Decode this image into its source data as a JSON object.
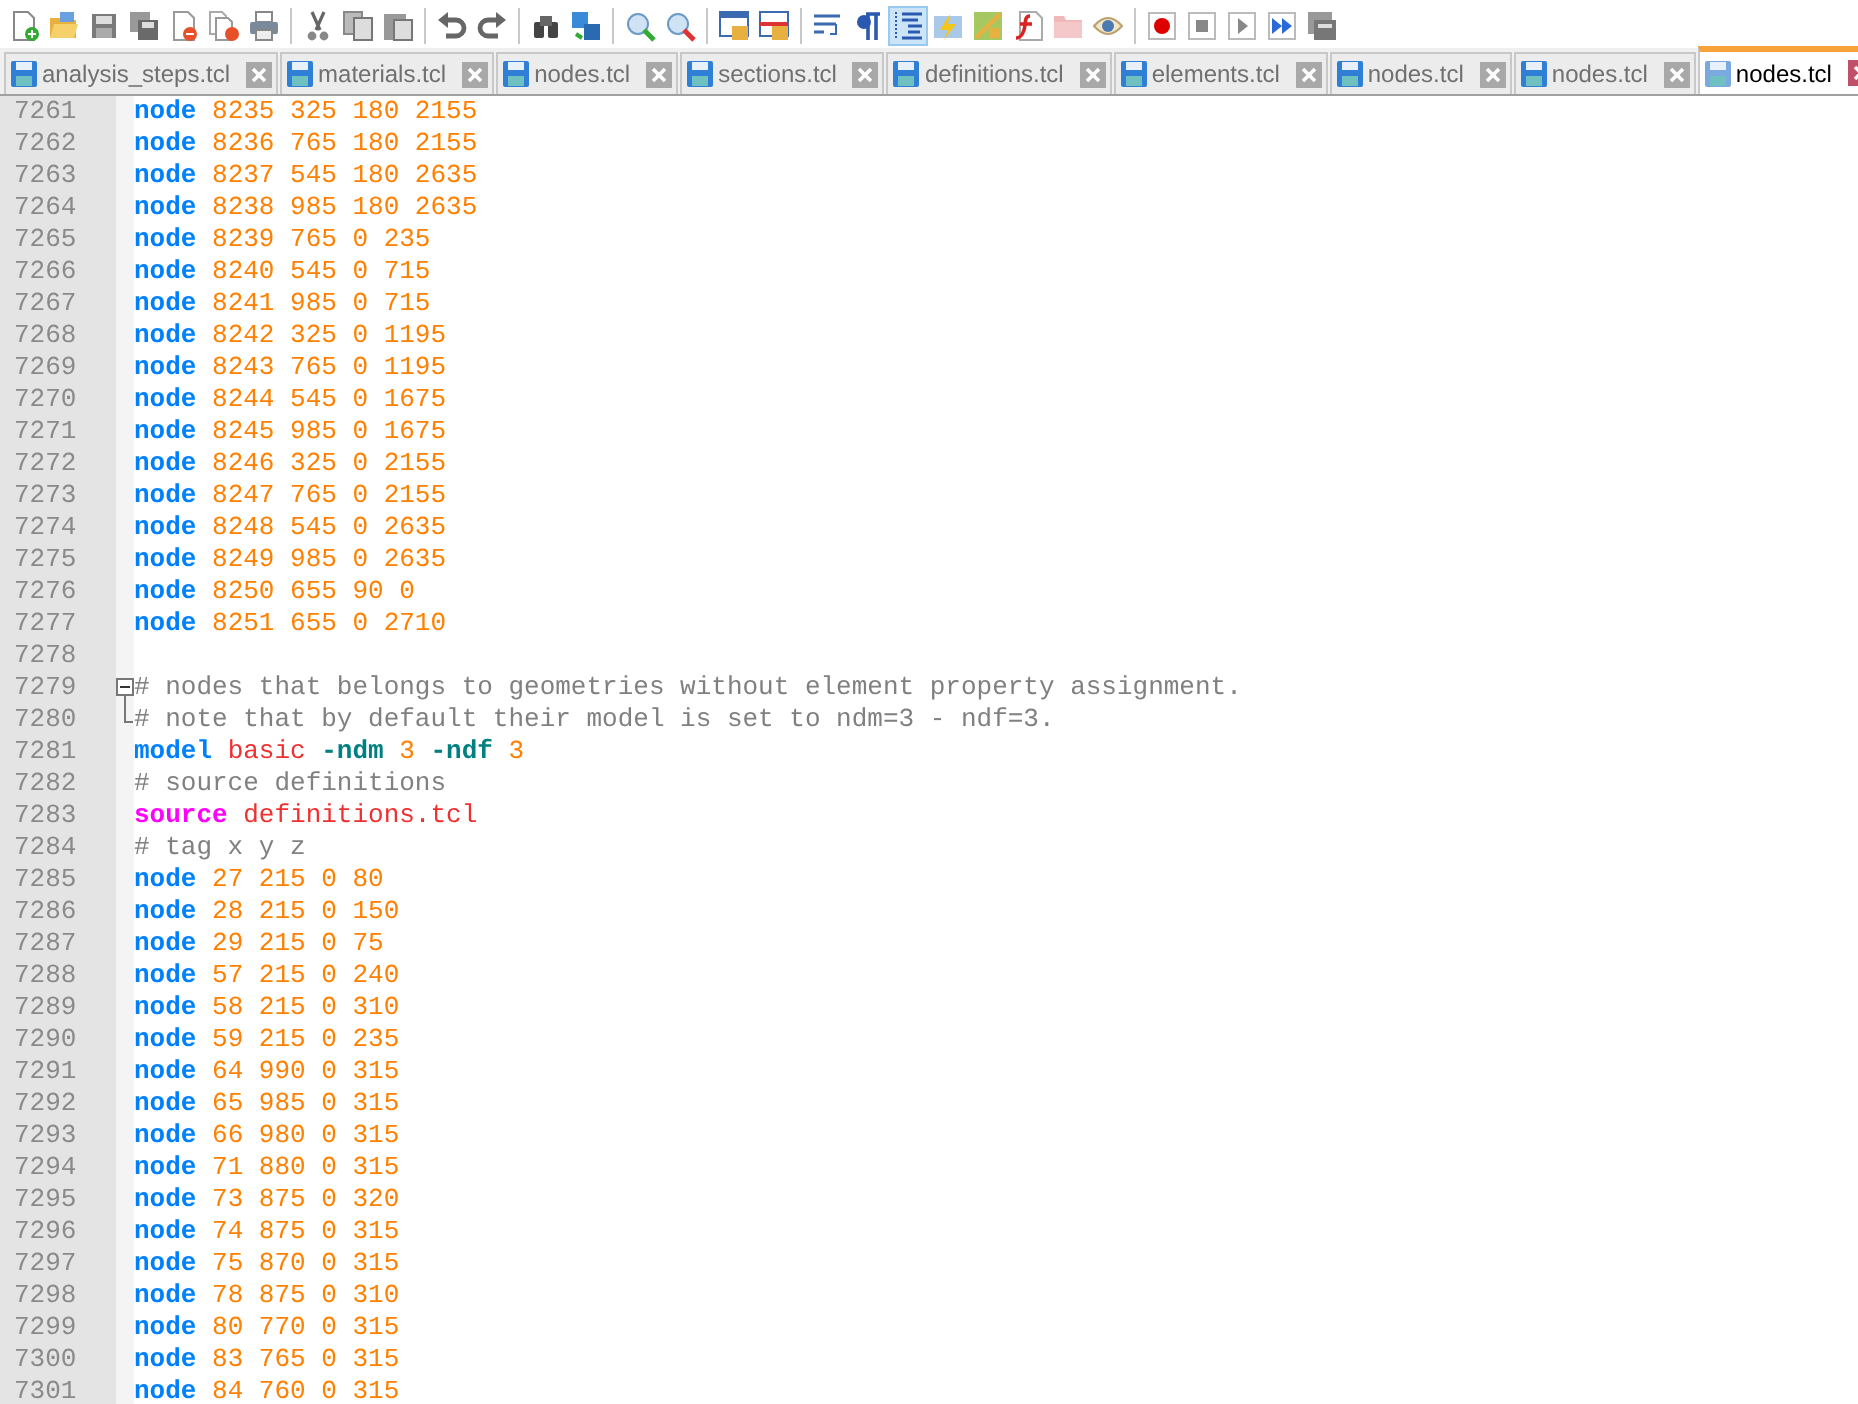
{
  "toolbar": [
    {
      "pressed": false
    },
    {
      "pressed": false
    },
    {
      "pressed": false
    },
    {
      "pressed": false
    },
    {
      "pressed": false
    },
    {
      "pressed": false
    },
    {
      "pressed": false
    },
    {
      "pressed": false
    },
    {
      "pressed": false
    },
    {
      "pressed": false
    },
    {
      "pressed": false
    },
    {
      "pressed": false
    },
    {
      "pressed": false
    },
    {
      "pressed": false
    },
    {
      "pressed": false
    },
    {
      "pressed": false
    },
    {
      "pressed": false
    },
    {
      "pressed": false
    },
    {
      "pressed": false
    },
    {
      "pressed": false
    },
    {
      "pressed": true
    },
    {
      "pressed": false
    },
    {
      "pressed": false
    },
    {
      "pressed": false
    },
    {
      "pressed": false
    },
    {
      "pressed": false
    },
    {
      "pressed": false
    },
    {
      "pressed": false
    },
    {
      "pressed": false
    },
    {
      "pressed": false
    },
    {
      "pressed": false
    }
  ],
  "tabs": [
    {
      "label": "analysis_steps.tcl",
      "selected": false
    },
    {
      "label": "materials.tcl",
      "selected": false
    },
    {
      "label": "nodes.tcl",
      "selected": false
    },
    {
      "label": "sections.tcl",
      "selected": false
    },
    {
      "label": "definitions.tcl",
      "selected": false
    },
    {
      "label": "elements.tcl",
      "selected": false
    },
    {
      "label": "nodes.tcl",
      "selected": false
    },
    {
      "label": "nodes.tcl",
      "selected": false
    },
    {
      "label": "nodes.tcl",
      "selected": true
    }
  ],
  "lines": [
    {
      "number": "7261",
      "tokens": [
        {
          "kind": "keyword",
          "text": "node"
        },
        {
          "kind": "number",
          "text": " 8235 325 180 2155"
        }
      ]
    },
    {
      "number": "7262",
      "tokens": [
        {
          "kind": "keyword",
          "text": "node"
        },
        {
          "kind": "number",
          "text": " 8236 765 180 2155"
        }
      ]
    },
    {
      "number": "7263",
      "tokens": [
        {
          "kind": "keyword",
          "text": "node"
        },
        {
          "kind": "number",
          "text": " 8237 545 180 2635"
        }
      ]
    },
    {
      "number": "7264",
      "tokens": [
        {
          "kind": "keyword",
          "text": "node"
        },
        {
          "kind": "number",
          "text": " 8238 985 180 2635"
        }
      ]
    },
    {
      "number": "7265",
      "tokens": [
        {
          "kind": "keyword",
          "text": "node"
        },
        {
          "kind": "number",
          "text": " 8239 765 0 235"
        }
      ]
    },
    {
      "number": "7266",
      "tokens": [
        {
          "kind": "keyword",
          "text": "node"
        },
        {
          "kind": "number",
          "text": " 8240 545 0 715"
        }
      ]
    },
    {
      "number": "7267",
      "tokens": [
        {
          "kind": "keyword",
          "text": "node"
        },
        {
          "kind": "number",
          "text": " 8241 985 0 715"
        }
      ]
    },
    {
      "number": "7268",
      "tokens": [
        {
          "kind": "keyword",
          "text": "node"
        },
        {
          "kind": "number",
          "text": " 8242 325 0 1195"
        }
      ]
    },
    {
      "number": "7269",
      "tokens": [
        {
          "kind": "keyword",
          "text": "node"
        },
        {
          "kind": "number",
          "text": " 8243 765 0 1195"
        }
      ]
    },
    {
      "number": "7270",
      "tokens": [
        {
          "kind": "keyword",
          "text": "node"
        },
        {
          "kind": "number",
          "text": " 8244 545 0 1675"
        }
      ]
    },
    {
      "number": "7271",
      "tokens": [
        {
          "kind": "keyword",
          "text": "node"
        },
        {
          "kind": "number",
          "text": " 8245 985 0 1675"
        }
      ]
    },
    {
      "number": "7272",
      "tokens": [
        {
          "kind": "keyword",
          "text": "node"
        },
        {
          "kind": "number",
          "text": " 8246 325 0 2155"
        }
      ]
    },
    {
      "number": "7273",
      "tokens": [
        {
          "kind": "keyword",
          "text": "node"
        },
        {
          "kind": "number",
          "text": " 8247 765 0 2155"
        }
      ]
    },
    {
      "number": "7274",
      "tokens": [
        {
          "kind": "keyword",
          "text": "node"
        },
        {
          "kind": "number",
          "text": " 8248 545 0 2635"
        }
      ]
    },
    {
      "number": "7275",
      "tokens": [
        {
          "kind": "keyword",
          "text": "node"
        },
        {
          "kind": "number",
          "text": " 8249 985 0 2635"
        }
      ]
    },
    {
      "number": "7276",
      "tokens": [
        {
          "kind": "keyword",
          "text": "node"
        },
        {
          "kind": "number",
          "text": " 8250 655 90 0"
        }
      ]
    },
    {
      "number": "7277",
      "tokens": [
        {
          "kind": "keyword",
          "text": "node"
        },
        {
          "kind": "number",
          "text": " 8251 655 0 2710"
        }
      ]
    },
    {
      "number": "7278"
    },
    {
      "number": "7279",
      "fold_start": true,
      "tokens": [
        {
          "kind": "comment",
          "text": "# nodes that belongs to geometries without element property assignment."
        }
      ]
    },
    {
      "number": "7280",
      "fold_end": true,
      "tokens": [
        {
          "kind": "comment",
          "text": "# note that by default their model is set to ndm=3 - ndf=3."
        }
      ]
    },
    {
      "number": "7281",
      "tokens": [
        {
          "kind": "keyword",
          "text": "model"
        },
        {
          "kind": "word",
          "text": " basic"
        },
        {
          "kind": "option",
          "text": " -ndm"
        },
        {
          "kind": "number",
          "text": " 3"
        },
        {
          "kind": "option",
          "text": " -ndf"
        },
        {
          "kind": "number",
          "text": " 3"
        }
      ]
    },
    {
      "number": "7282",
      "tokens": [
        {
          "kind": "comment",
          "text": "# source definitions"
        }
      ]
    },
    {
      "number": "7283",
      "tokens": [
        {
          "kind": "command",
          "text": "source"
        },
        {
          "kind": "word",
          "text": " definitions.tcl"
        }
      ]
    },
    {
      "number": "7284",
      "tokens": [
        {
          "kind": "comment",
          "text": "# tag x y z"
        }
      ]
    },
    {
      "number": "7285",
      "tokens": [
        {
          "kind": "keyword",
          "text": "node"
        },
        {
          "kind": "number",
          "text": " 27 215 0 80"
        }
      ]
    },
    {
      "number": "7286",
      "tokens": [
        {
          "kind": "keyword",
          "text": "node"
        },
        {
          "kind": "number",
          "text": " 28 215 0 150"
        }
      ]
    },
    {
      "number": "7287",
      "tokens": [
        {
          "kind": "keyword",
          "text": "node"
        },
        {
          "kind": "number",
          "text": " 29 215 0 75"
        }
      ]
    },
    {
      "number": "7288",
      "tokens": [
        {
          "kind": "keyword",
          "text": "node"
        },
        {
          "kind": "number",
          "text": " 57 215 0 240"
        }
      ]
    },
    {
      "number": "7289",
      "tokens": [
        {
          "kind": "keyword",
          "text": "node"
        },
        {
          "kind": "number",
          "text": " 58 215 0 310"
        }
      ]
    },
    {
      "number": "7290",
      "tokens": [
        {
          "kind": "keyword",
          "text": "node"
        },
        {
          "kind": "number",
          "text": " 59 215 0 235"
        }
      ]
    },
    {
      "number": "7291",
      "tokens": [
        {
          "kind": "keyword",
          "text": "node"
        },
        {
          "kind": "number",
          "text": " 64 990 0 315"
        }
      ]
    },
    {
      "number": "7292",
      "tokens": [
        {
          "kind": "keyword",
          "text": "node"
        },
        {
          "kind": "number",
          "text": " 65 985 0 315"
        }
      ]
    },
    {
      "number": "7293",
      "tokens": [
        {
          "kind": "keyword",
          "text": "node"
        },
        {
          "kind": "number",
          "text": " 66 980 0 315"
        }
      ]
    },
    {
      "number": "7294",
      "tokens": [
        {
          "kind": "keyword",
          "text": "node"
        },
        {
          "kind": "number",
          "text": " 71 880 0 315"
        }
      ]
    },
    {
      "number": "7295",
      "tokens": [
        {
          "kind": "keyword",
          "text": "node"
        },
        {
          "kind": "number",
          "text": " 73 875 0 320"
        }
      ]
    },
    {
      "number": "7296",
      "tokens": [
        {
          "kind": "keyword",
          "text": "node"
        },
        {
          "kind": "number",
          "text": " 74 875 0 315"
        }
      ]
    },
    {
      "number": "7297",
      "tokens": [
        {
          "kind": "keyword",
          "text": "node"
        },
        {
          "kind": "number",
          "text": " 75 870 0 315"
        }
      ]
    },
    {
      "number": "7298",
      "tokens": [
        {
          "kind": "keyword",
          "text": "node"
        },
        {
          "kind": "number",
          "text": " 78 875 0 310"
        }
      ]
    },
    {
      "number": "7299",
      "tokens": [
        {
          "kind": "keyword",
          "text": "node"
        },
        {
          "kind": "number",
          "text": " 80 770 0 315"
        }
      ]
    },
    {
      "number": "7300",
      "tokens": [
        {
          "kind": "keyword",
          "text": "node"
        },
        {
          "kind": "number",
          "text": " 83 765 0 315"
        }
      ]
    },
    {
      "number": "7301",
      "tokens": [
        {
          "kind": "keyword",
          "text": "node"
        },
        {
          "kind": "number",
          "text": " 84 760 0 315"
        }
      ]
    }
  ]
}
